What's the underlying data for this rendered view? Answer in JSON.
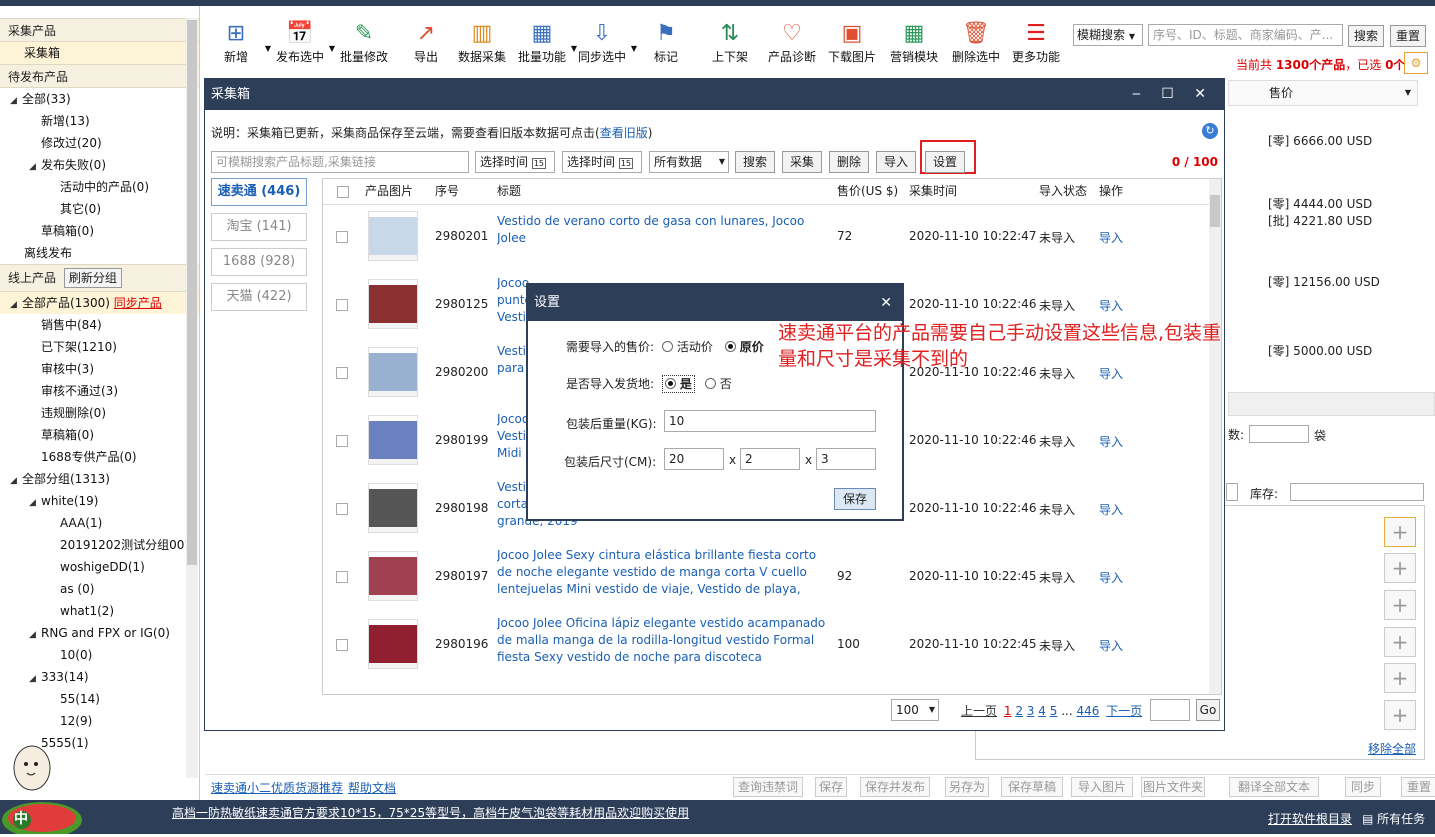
{
  "sidebar": {
    "sec1": "采集产品",
    "collect_box": "采集箱",
    "sec2": "待发布产品",
    "pending": [
      {
        "l": "全部(33)",
        "d": 0,
        "t": "▲"
      },
      {
        "l": "新增(13)",
        "d": 1
      },
      {
        "l": "修改过(20)",
        "d": 1
      },
      {
        "l": "发布失败(0)",
        "d": 1,
        "t": "▲"
      },
      {
        "l": "活动中的产品(0)",
        "d": 2
      },
      {
        "l": "其它(0)",
        "d": 2
      },
      {
        "l": "草稿箱(0)",
        "d": 1
      },
      {
        "l": "离线发布",
        "d": -1
      }
    ],
    "sec3": "线上产品",
    "refresh": "刷新分组",
    "online_all": "全部产品(1300)",
    "sync": "同步产品",
    "online": [
      {
        "l": "销售中(84)",
        "d": 1
      },
      {
        "l": "已下架(1210)",
        "d": 1
      },
      {
        "l": "审核中(3)",
        "d": 1
      },
      {
        "l": "审核不通过(3)",
        "d": 1
      },
      {
        "l": "违规删除(0)",
        "d": 1
      },
      {
        "l": "草稿箱(0)",
        "d": 1
      },
      {
        "l": "1688专供产品(0)",
        "d": 1
      },
      {
        "l": "全部分组(1313)",
        "d": 0,
        "t": "▲"
      },
      {
        "l": "white(19)",
        "d": 1,
        "t": "▲"
      },
      {
        "l": "AAA(1)",
        "d": 2
      },
      {
        "l": "20191202测试分组001",
        "d": 2
      },
      {
        "l": "woshigeDD(1)",
        "d": 2
      },
      {
        "l": "as (0)",
        "d": 2
      },
      {
        "l": "what1(2)",
        "d": 2
      },
      {
        "l": "RNG and FPX or IG(0)",
        "d": 1,
        "t": "▲"
      },
      {
        "l": "10(0)",
        "d": 2
      },
      {
        "l": "333(14)",
        "d": 1,
        "t": "▲"
      },
      {
        "l": "55(14)",
        "d": 2
      },
      {
        "l": "12(9)",
        "d": 2
      },
      {
        "l": "5555(1)",
        "d": 1
      }
    ]
  },
  "toolbar": [
    {
      "l": "新增",
      "i": "⊞",
      "a": 1
    },
    {
      "l": "发布选中",
      "i": "📅",
      "a": 1
    },
    {
      "l": "批量修改",
      "i": "✎"
    },
    {
      "l": "导出",
      "i": "↗"
    },
    {
      "l": "数据采集",
      "i": "▥"
    },
    {
      "l": "批量功能",
      "i": "▦",
      "a": 1
    },
    {
      "l": "同步选中",
      "i": "⇩",
      "a": 1
    },
    {
      "l": "标记",
      "i": "⚑"
    },
    {
      "l": "上下架",
      "i": "⇅"
    },
    {
      "l": "产品诊断",
      "i": "♡"
    },
    {
      "l": "下载图片",
      "i": "▣"
    },
    {
      "l": "营销模块",
      "i": "▦"
    },
    {
      "l": "删除选中",
      "i": "🗑"
    },
    {
      "l": "更多功能",
      "i": "☰"
    }
  ],
  "search": {
    "mode": "模糊搜索",
    "placeholder": "序号、ID、标题、商家编码、产...",
    "btn": "搜索",
    "reset": "重置"
  },
  "summary": {
    "pre": "当前共 ",
    "count": "1300个产品",
    "mid": "，已选 ",
    "sel": "0个"
  },
  "right": {
    "price_hdr": "售价",
    "prices": [
      "[零] 6666.00 USD",
      "[零] 4444.00 USD",
      "[批] 4221.80 USD",
      "[零] 12156.00 USD",
      "[零] 5000.00 USD"
    ],
    "unit": "袋",
    "shu": "数:",
    "stock": "库存:",
    "remove_all": "移除全部"
  },
  "dialog": {
    "title": "采集箱",
    "notice": "说明：采集箱已更新，采集商品保存至云端，需要查看旧版本数据可点击(",
    "notice_link": "查看旧版",
    "notice_end": ")",
    "search_ph": "可模糊搜索产品标题,采集链接",
    "time1": "选择时间",
    "time2": "选择时间",
    "all": "所有数据",
    "btns": [
      "搜索",
      "采集",
      "删除",
      "导入"
    ],
    "settings_btn": "设置",
    "counter": "0 / 100",
    "tabs": [
      "速卖通 (446)",
      "淘宝 (141)",
      "1688 (928)",
      "天猫 (422)"
    ],
    "headers": [
      "产品图片",
      "序号",
      "标题",
      "售价(US $)",
      "采集时间",
      "导入状态",
      "操作"
    ],
    "rows": [
      {
        "id": "2980201",
        "title": "Vestido de verano corto de gasa con lunares, Jocoo Jolee",
        "price": "72",
        "time": "2020-11-10 10:22:47",
        "st": "未导入",
        "op": "导入"
      },
      {
        "id": "2980125",
        "title": "Jocoo\npunto\nVesti",
        "price": "",
        "time": "2020-11-10 10:22:46",
        "st": "未导入",
        "op": "导入"
      },
      {
        "id": "2980200",
        "title": "Vesti\npara",
        "price": "",
        "time": "2020-11-10 10:22:46",
        "st": "未导入",
        "op": "导入"
      },
      {
        "id": "2980199",
        "title": "Jocoo\nVesti\nMidi",
        "price": "",
        "time": "2020-11-10 10:22:46",
        "st": "未导入",
        "op": "导入"
      },
      {
        "id": "2980198",
        "title": "Vesti\ncorta\ngrande, 2019",
        "price": "",
        "time": "2020-11-10 10:22:46",
        "st": "未导入",
        "op": "导入"
      },
      {
        "id": "2980197",
        "title": "Jocoo Jolee Sexy cintura elástica brillante fiesta corto de noche elegante vestido de manga corta V cuello lentejuelas Mini vestido de viaje, Vestido de playa,",
        "price": "92",
        "time": "2020-11-10 10:22:45",
        "st": "未导入",
        "op": "导入"
      },
      {
        "id": "2980196",
        "title": "Jocoo Jolee Oficina lápiz elegante vestido acampanado de malla manga de la rodilla-longitud vestido Formal fiesta Sexy vestido de noche para discoteca",
        "price": "100",
        "time": "2020-11-10 10:22:45",
        "st": "未导入",
        "op": "导入"
      }
    ],
    "page_size": "100",
    "prev": "上一页",
    "pages": [
      "1",
      "2",
      "3",
      "4",
      "5"
    ],
    "ellipsis": "...",
    "last": "446",
    "next": "下一页",
    "go": "Go"
  },
  "settings": {
    "title": "设置",
    "price_lbl": "需要导入的售价:",
    "opt1": "活动价",
    "opt2": "原价",
    "ship_lbl": "是否导入发货地:",
    "yes": "是",
    "no": "否",
    "weight_lbl": "包装后重量(KG):",
    "weight": "10",
    "size_lbl": "包装后尺寸(CM):",
    "l": "20",
    "w": "2",
    "h": "3",
    "x": "x",
    "save": "保存"
  },
  "annotation": "速卖通平台的产品需要自己手动设置这些信息,包装重量和尺寸是采集不到的",
  "bottom": {
    "link1": "速卖通小二优质货源推荐",
    "link2": "帮助文档",
    "btns": [
      "查询违禁词",
      "保存",
      "保存并发布",
      "另存为",
      "保存草稿",
      "导入图片",
      "图片文件夹",
      "翻译全部文本",
      "同步",
      "重置"
    ]
  },
  "status": {
    "ime": "中",
    "marquee": "高档一防热敏纸速卖通官方要求10*15，75*25等型号，高档牛皮气泡袋等耗材用品欢迎购买使用",
    "open_dir": "打开软件根目录",
    "tasks": "所有任务"
  }
}
